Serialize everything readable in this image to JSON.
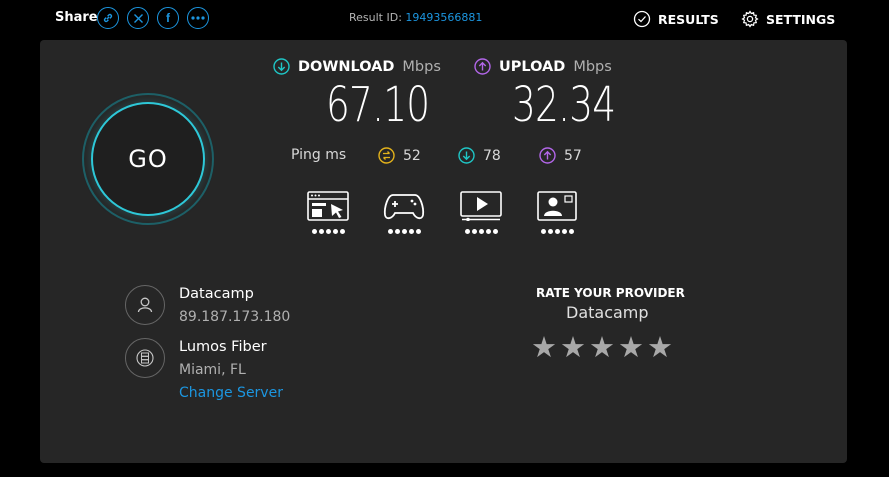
{
  "header": {
    "share_label": "Share",
    "share_icons": [
      "link-icon",
      "x-icon",
      "facebook-icon",
      "more-icon"
    ],
    "result_id_label": "Result ID:",
    "result_id": "19493566881",
    "results_label": "RESULTS",
    "settings_label": "SETTINGS"
  },
  "go": {
    "label": "GO"
  },
  "download": {
    "label": "DOWNLOAD",
    "unit": "Mbps",
    "value": "67.10",
    "color": "#1fc6c6"
  },
  "upload": {
    "label": "UPLOAD",
    "unit": "Mbps",
    "value": "32.34",
    "color": "#b266e8"
  },
  "ping": {
    "label": "Ping ms",
    "idle": "52",
    "download": "78",
    "upload": "57",
    "idle_color": "#e3b21b"
  },
  "categories": [
    {
      "icon": "browsing-icon",
      "rating": 5
    },
    {
      "icon": "gaming-icon",
      "rating": 5
    },
    {
      "icon": "streaming-icon",
      "rating": 5
    },
    {
      "icon": "video-call-icon",
      "rating": 5
    }
  ],
  "connection": {
    "provider": "Datacamp",
    "ip": "89.187.173.180",
    "server": "Lumos Fiber",
    "location": "Miami, FL",
    "change_server": "Change Server"
  },
  "rating": {
    "title": "RATE YOUR PROVIDER",
    "provider": "Datacamp",
    "stars": 5
  },
  "colors": {
    "accent_blue": "#1c96e0",
    "panel_bg": "#262626",
    "go_ring": "#2ec8d8"
  }
}
